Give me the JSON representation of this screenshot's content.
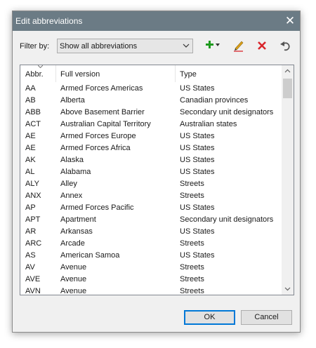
{
  "window": {
    "title": "Edit abbreviations",
    "close_glyph": "✕"
  },
  "filter": {
    "label": "Filter by:",
    "selected": "Show all abbreviations"
  },
  "toolbar": {
    "add_icon": "plus-dropdown-icon",
    "edit_icon": "pencil-icon",
    "delete_icon": "red-x-icon",
    "undo_icon": "undo-arrow-icon",
    "colors": {
      "add": "#1f9a1f",
      "delete": "#d9262c",
      "edit": "#e0a21b",
      "undo": "#555555"
    }
  },
  "list": {
    "columns": [
      "Abbr.",
      "Full version",
      "Type"
    ],
    "rows": [
      [
        "AA",
        "Armed Forces Americas",
        "US States"
      ],
      [
        "AB",
        "Alberta",
        "Canadian provinces"
      ],
      [
        "ABB",
        "Above Basement Barrier",
        "Secondary unit designators"
      ],
      [
        "ACT",
        "Australian Capital Territory",
        "Australian states"
      ],
      [
        "AE",
        "Armed Forces Europe",
        "US States"
      ],
      [
        "AE",
        "Armed Forces Africa",
        "US States"
      ],
      [
        "AK",
        "Alaska",
        "US States"
      ],
      [
        "AL",
        "Alabama",
        "US States"
      ],
      [
        "ALY",
        "Alley",
        "Streets"
      ],
      [
        "ANX",
        "Annex",
        "Streets"
      ],
      [
        "AP",
        "Armed Forces Pacific",
        "US States"
      ],
      [
        "APT",
        "Apartment",
        "Secondary unit designators"
      ],
      [
        "AR",
        "Arkansas",
        "US States"
      ],
      [
        "ARC",
        "Arcade",
        "Streets"
      ],
      [
        "AS",
        "American Samoa",
        "US States"
      ],
      [
        "AV",
        "Avenue",
        "Streets"
      ],
      [
        "AVE",
        "Avenue",
        "Streets"
      ],
      [
        "AVN",
        "Avenue",
        "Streets"
      ]
    ]
  },
  "buttons": {
    "ok": "OK",
    "cancel": "Cancel"
  },
  "accent": "#0078d7"
}
